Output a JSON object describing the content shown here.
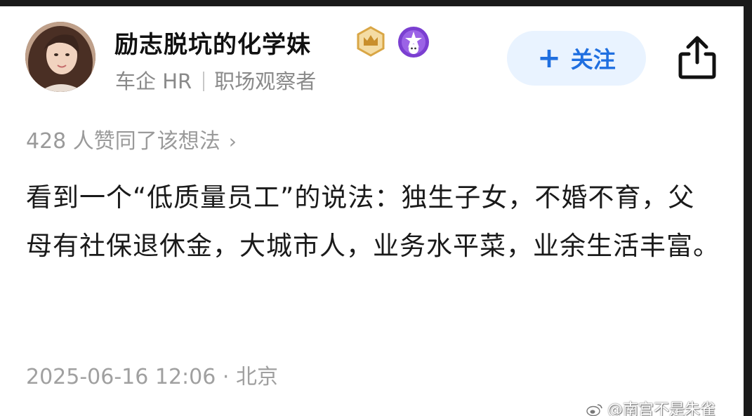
{
  "header": {
    "username": "励志脱坑的化学妹",
    "badges": [
      {
        "icon": "crown-badge-icon",
        "color": "#e3b65a"
      },
      {
        "icon": "star-avatar-badge-icon",
        "color": "#7b3fd1"
      }
    ],
    "subtitle_role": "车企 HR",
    "subtitle_tag": "职场观察者",
    "follow_plus": "+",
    "follow_label": "关注",
    "share_icon": "share-icon"
  },
  "likes": {
    "text": "428 人赞同了该想法",
    "chevron": "›"
  },
  "post": {
    "body": "看到一个“低质量员工”的说法：独生子女，不婚不育，父母有社保退休金，大城市人，业务水平菜，业余生活丰富。"
  },
  "footer": {
    "timestamp": "2025-06-16 12:06 · 北京",
    "watermark": "@南宫不是朱雀"
  },
  "colors": {
    "accent": "#1f6fe0",
    "follow_bg": "#e9f3ff",
    "text_primary": "#1a1a1a",
    "text_secondary": "#8a8a8a"
  }
}
